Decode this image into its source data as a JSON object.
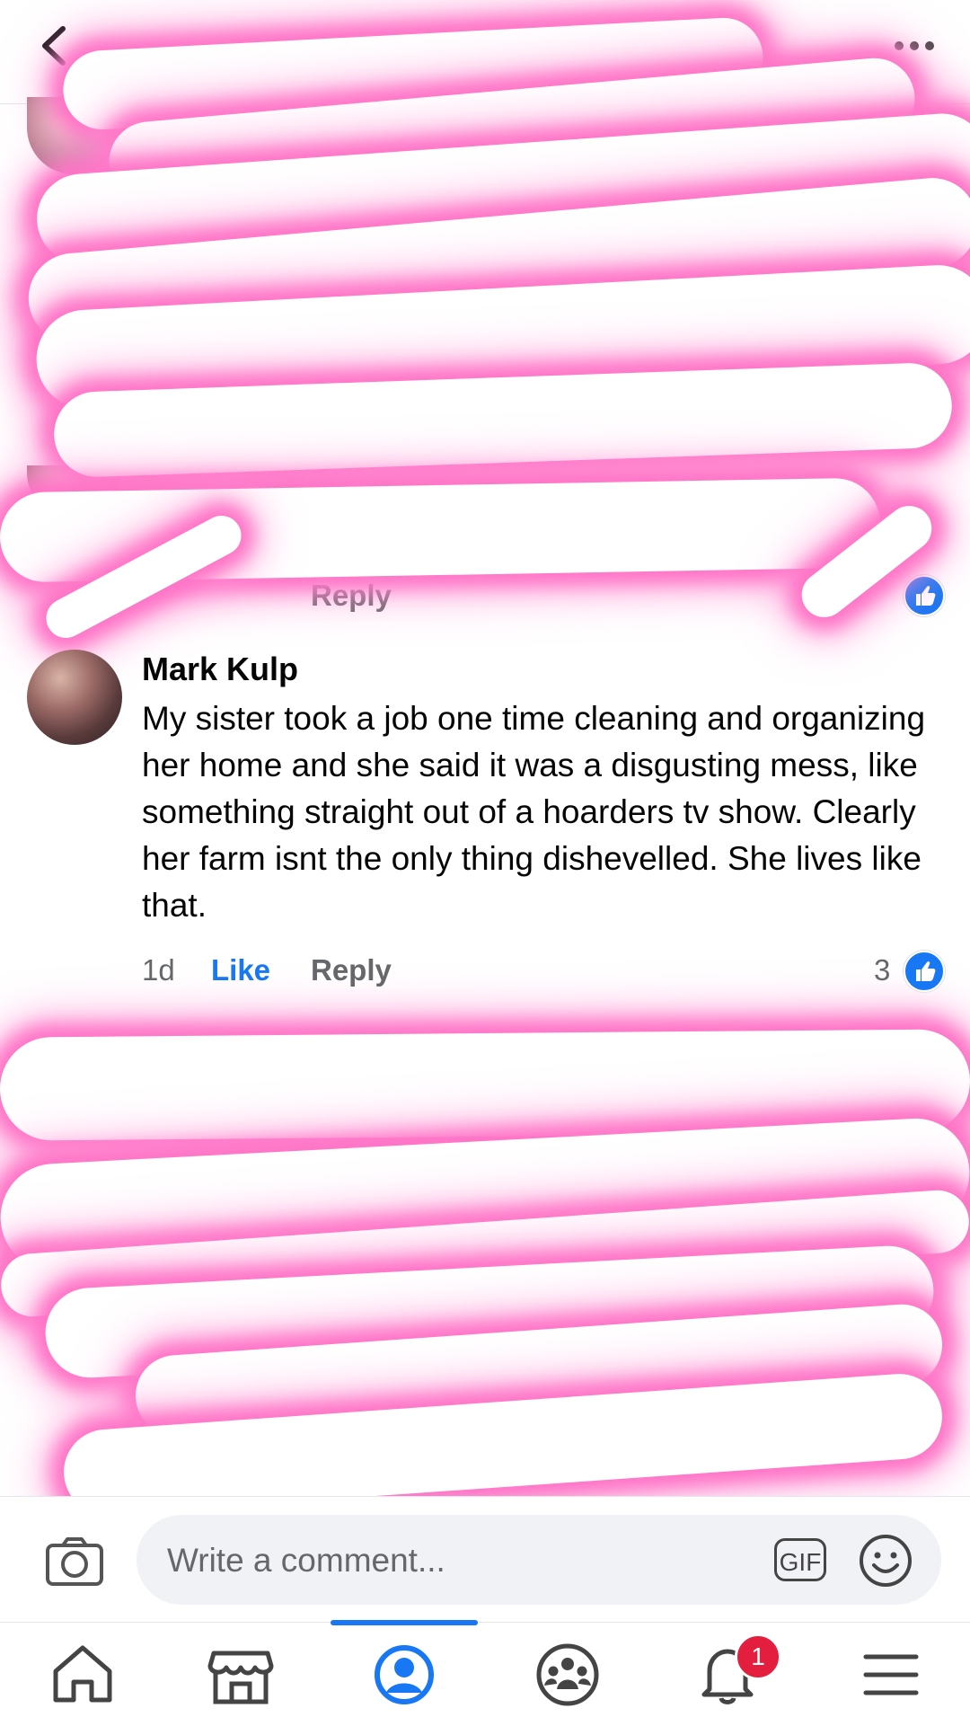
{
  "comment": {
    "author": "Mark Kulp",
    "body": "My sister took a job one time cleaning and organizing her home and she said it was a disgusting mess, like something straight out of a hoarders tv show. Clearly her farm isnt the only thing dishevelled. She lives like that.",
    "timestamp": "1d",
    "like_label": "Like",
    "reply_label": "Reply",
    "reaction_count": "3"
  },
  "previous_comment": {
    "reply_label": "Reply"
  },
  "composer": {
    "placeholder": "Write a comment...",
    "gif_label": "GIF"
  },
  "bottom_nav": {
    "notification_count": "1",
    "active_tab": "profile"
  },
  "colors": {
    "accent": "#1877f2",
    "badge": "#e41e3f",
    "redaction_glow": "#ff73c6"
  },
  "icons": [
    "chevron-left-icon",
    "more-horizontal-icon",
    "thumbs-up-icon",
    "camera-icon",
    "gif-icon",
    "smiley-icon",
    "home-icon",
    "marketplace-icon",
    "profile-icon",
    "groups-icon",
    "bell-icon",
    "menu-icon"
  ]
}
